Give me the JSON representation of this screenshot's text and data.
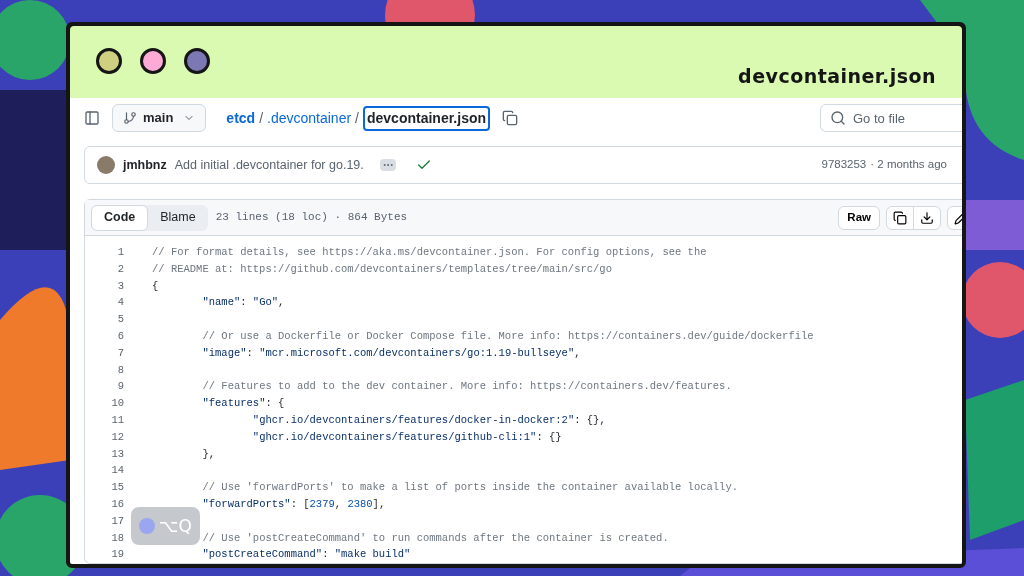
{
  "window": {
    "title": "devcontainer.json",
    "dots": [
      {
        "color": "#cfcf82"
      },
      {
        "color": "#fdaad6"
      },
      {
        "color": "#7b78b4"
      }
    ]
  },
  "breadcrumb": {
    "branch": "main",
    "parts": [
      {
        "text": "etcd",
        "kind": "repo"
      },
      {
        "text": "/",
        "kind": "sep"
      },
      {
        "text": ".devcontainer",
        "kind": "dir"
      },
      {
        "text": "/",
        "kind": "sep"
      },
      {
        "text": "devcontainer.json",
        "kind": "file"
      }
    ]
  },
  "search": {
    "placeholder": "Go to file"
  },
  "commit": {
    "author": "jmhbnz",
    "message": "Add initial .devcontainer for go.19.",
    "checks_passed": true,
    "sha": "9783253",
    "time": "· 2 months ago"
  },
  "file_header": {
    "tabs": [
      {
        "label": "Code",
        "selected": true
      },
      {
        "label": "Blame",
        "selected": false
      }
    ],
    "info": "23 lines (18 loc) · 864 Bytes",
    "raw": "Raw"
  },
  "lines": [
    {
      "number": "1",
      "segments": [
        {
          "kind": "comment",
          "text": "// For format details, see https://aka.ms/devcontainer.json. For config options, see the"
        }
      ]
    },
    {
      "number": "2",
      "segments": [
        {
          "kind": "comment",
          "text": "// README at: https://github.com/devcontainers/templates/tree/main/src/go"
        }
      ]
    },
    {
      "number": "3",
      "segments": [
        {
          "kind": "punct",
          "text": "{"
        }
      ]
    },
    {
      "number": "4",
      "segments": [
        {
          "kind": "key",
          "text": "\t\"name\""
        },
        {
          "kind": "punct",
          "text": ": "
        },
        {
          "kind": "string",
          "text": "\"Go\""
        },
        {
          "kind": "punct",
          "text": ","
        }
      ]
    },
    {
      "number": "5"
    },
    {
      "number": "6",
      "segments": [
        {
          "kind": "comment",
          "text": "\t// Or use a Dockerfile or Docker Compose file. More info: https://containers.dev/guide/dockerfile"
        }
      ]
    },
    {
      "number": "7",
      "segments": [
        {
          "kind": "key",
          "text": "\t\"image\""
        },
        {
          "kind": "punct",
          "text": ": "
        },
        {
          "kind": "string",
          "text": "\"mcr.microsoft.com/devcontainers/go:1.19-bullseye\""
        },
        {
          "kind": "punct",
          "text": ","
        }
      ]
    },
    {
      "number": "8"
    },
    {
      "number": "9",
      "segments": [
        {
          "kind": "comment",
          "text": "\t// Features to add to the dev container. More info: https://containers.dev/features."
        }
      ]
    },
    {
      "number": "10",
      "segments": [
        {
          "kind": "key",
          "text": "\t\"features\""
        },
        {
          "kind": "punct",
          "text": ": {"
        }
      ]
    },
    {
      "number": "11",
      "segments": [
        {
          "kind": "key",
          "text": "\t\t\"ghcr.io/devcontainers/features/docker-in-docker:2\""
        },
        {
          "kind": "punct",
          "text": ": {},"
        }
      ]
    },
    {
      "number": "12",
      "segments": [
        {
          "kind": "key",
          "text": "\t\t\"ghcr.io/devcontainers/features/github-cli:1\""
        },
        {
          "kind": "punct",
          "text": ": {}"
        }
      ]
    },
    {
      "number": "13",
      "segments": [
        {
          "kind": "punct",
          "text": "\t},"
        }
      ]
    },
    {
      "number": "14"
    },
    {
      "number": "15",
      "segments": [
        {
          "kind": "comment",
          "text": "\t// Use 'forwardPorts' to make a list of ports inside the container available locally."
        }
      ]
    },
    {
      "number": "16",
      "segments": [
        {
          "kind": "key",
          "text": "\t\"forwardPorts\""
        },
        {
          "kind": "punct",
          "text": ": ["
        },
        {
          "kind": "number",
          "text": "2379"
        },
        {
          "kind": "punct",
          "text": ", "
        },
        {
          "kind": "number",
          "text": "2380"
        },
        {
          "kind": "punct",
          "text": "],"
        }
      ]
    },
    {
      "number": "17"
    },
    {
      "number": "18",
      "segments": [
        {
          "kind": "comment",
          "text": "\t// Use 'postCreateCommand' to run commands after the container is created."
        }
      ]
    },
    {
      "number": "19",
      "segments": [
        {
          "kind": "key",
          "text": "\t\"postCreateCommand\""
        },
        {
          "kind": "punct",
          "text": ": "
        },
        {
          "kind": "string",
          "text": "\"make build\""
        }
      ]
    }
  ],
  "shortcut_badge": {
    "keys": "⌥Q"
  }
}
